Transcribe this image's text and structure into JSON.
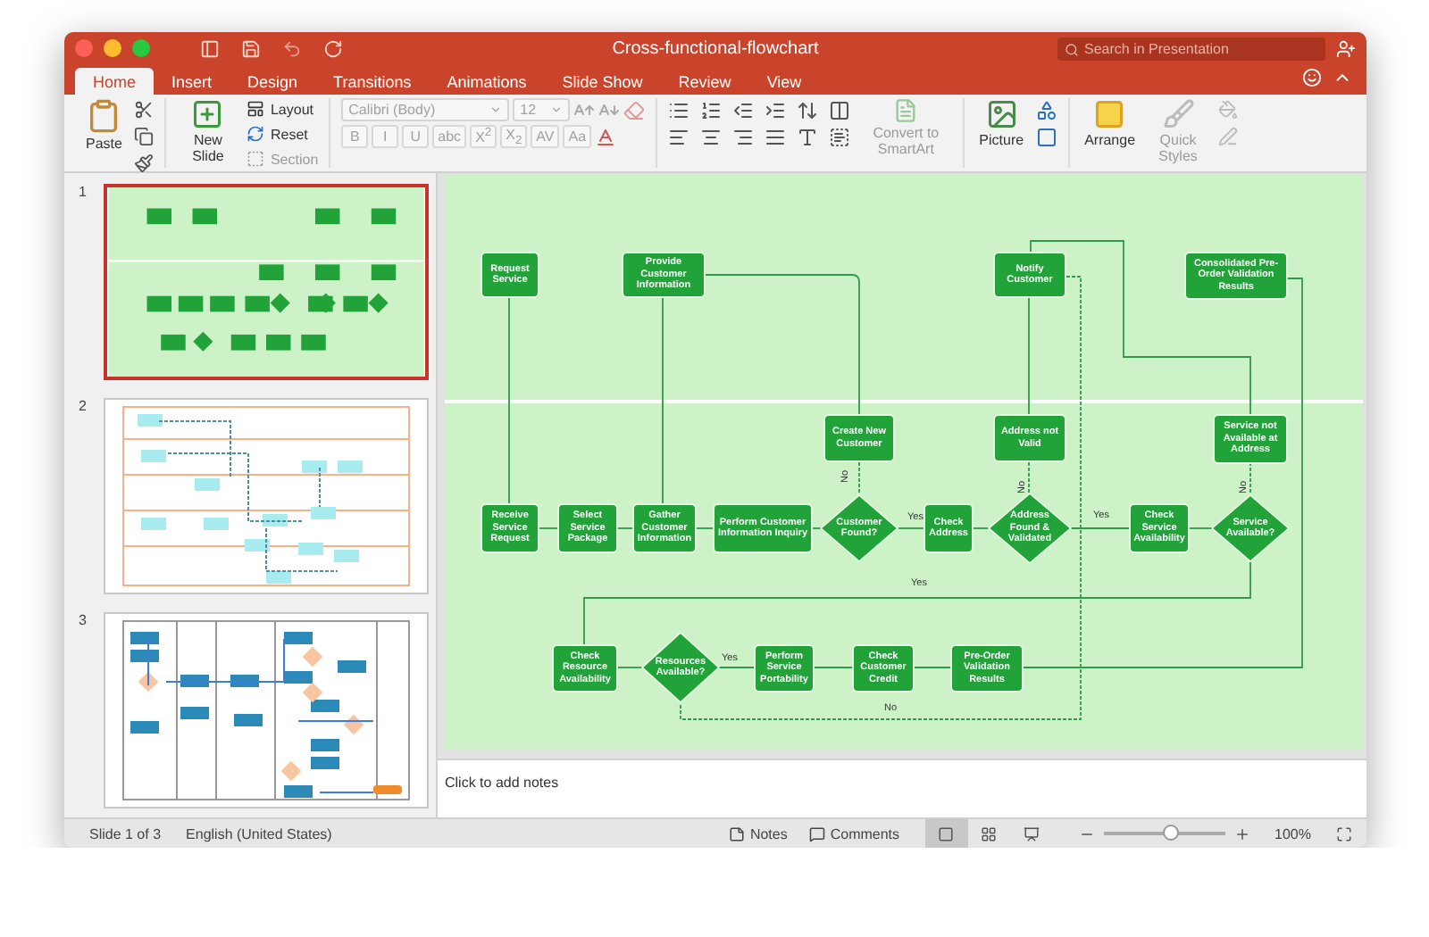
{
  "window": {
    "title": "Cross-functional-flowchart",
    "search": {
      "placeholder": "Search in Presentation"
    }
  },
  "tabs": [
    {
      "label": "Home",
      "selected": true
    },
    {
      "label": "Insert",
      "selected": false
    },
    {
      "label": "Design",
      "selected": false
    },
    {
      "label": "Transitions",
      "selected": false
    },
    {
      "label": "Animations",
      "selected": false
    },
    {
      "label": "Slide Show",
      "selected": false
    },
    {
      "label": "Review",
      "selected": false
    },
    {
      "label": "View",
      "selected": false
    }
  ],
  "ribbon": {
    "paste": "Paste",
    "new_slide": "New Slide",
    "layout": "Layout",
    "reset": "Reset",
    "section": {
      "label": "Section",
      "disabled": true
    },
    "font": {
      "name": "Calibri (Body)",
      "size": "12",
      "disabled": true,
      "format_buttons": [
        "B",
        "I",
        "U",
        "abc",
        "X$^{2}$",
        "X$_{2}$",
        "AV",
        "Aa"
      ]
    },
    "convert": {
      "label": "Convert to SmartArt",
      "disabled": true
    },
    "picture": "Picture",
    "arrange": "Arrange",
    "quick_styles": {
      "label": "Quick Styles",
      "disabled": true
    }
  },
  "slides": [
    {
      "number": "1",
      "selected": true,
      "kind": "green"
    },
    {
      "number": "2",
      "selected": false,
      "kind": "cyan"
    },
    {
      "number": "3",
      "selected": false,
      "kind": "blue"
    }
  ],
  "flowchart": {
    "nodes": [
      {
        "text": "Request Service",
        "kind": "process"
      },
      {
        "text": "Provide Customer Information",
        "kind": "process"
      },
      {
        "text": "Notify Customer",
        "kind": "process"
      },
      {
        "text": "Consolidated Pre-Order Validation Results",
        "kind": "process"
      },
      {
        "text": "Create New Customer",
        "kind": "process"
      },
      {
        "text": "Address not Valid",
        "kind": "process"
      },
      {
        "text": "Service not Available at Address",
        "kind": "process"
      },
      {
        "text": "Receive Service Request",
        "kind": "process"
      },
      {
        "text": "Select Service Package",
        "kind": "process"
      },
      {
        "text": "Gather Customer Information",
        "kind": "process"
      },
      {
        "text": "Perform Customer Information Inquiry",
        "kind": "process"
      },
      {
        "text": "Customer Found?",
        "kind": "decision"
      },
      {
        "text": "Check Address",
        "kind": "process"
      },
      {
        "text": "Address Found & Validated",
        "kind": "decision"
      },
      {
        "text": "Check Service Availability",
        "kind": "process"
      },
      {
        "text": "Service Available?",
        "kind": "decision"
      },
      {
        "text": "Check Resource Availability",
        "kind": "process"
      },
      {
        "text": "Resources Available?",
        "kind": "decision"
      },
      {
        "text": "Perform Service Portability",
        "kind": "process"
      },
      {
        "text": "Check Customer Credit",
        "kind": "process"
      },
      {
        "text": "Pre-Order Validation Results",
        "kind": "process"
      }
    ],
    "edge_labels": [
      "No",
      "Yes",
      "No",
      "Yes",
      "No",
      "Yes",
      "Yes",
      "No"
    ]
  },
  "notes": {
    "placeholder": "Click to add notes"
  },
  "status_bar": {
    "slide": "Slide 1 of 3",
    "language": "English (United States)",
    "notes": "Notes",
    "comments": "Comments",
    "zoom": {
      "level": 0.55,
      "reading": "100%"
    }
  }
}
